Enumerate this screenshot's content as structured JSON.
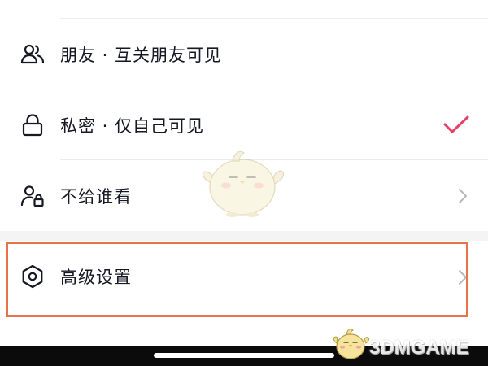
{
  "privacy_options": {
    "friends": {
      "label": "朋友 · 互关朋友可见",
      "icon": "two-people-icon",
      "selected": false
    },
    "private": {
      "label": "私密 · 仅自己可见",
      "icon": "lock-icon",
      "selected": true
    },
    "exclude": {
      "label": "不给谁看",
      "icon": "person-lock-icon",
      "selected": false
    }
  },
  "advanced": {
    "label": "高级设置",
    "icon": "hexagon-settings-icon"
  },
  "colors": {
    "check": "#e94165",
    "highlight": "#e8734a",
    "text": "#161823",
    "chevron": "#b9b9b9",
    "divider": "#ececec"
  },
  "watermark": {
    "logo_text": "3DMGAME"
  }
}
